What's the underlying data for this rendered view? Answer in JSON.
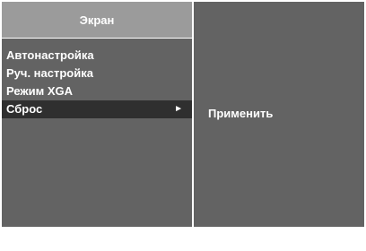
{
  "left_panel": {
    "title": "Экран",
    "items": [
      {
        "label": "Автонастройка",
        "selected": false
      },
      {
        "label": "Руч. настройка",
        "selected": false
      },
      {
        "label": "Режим XGA",
        "selected": false
      },
      {
        "label": "Сброс",
        "selected": true,
        "submenu_icon": "right-triangle-icon",
        "submenu_glyph": "►"
      }
    ]
  },
  "right_panel": {
    "option": "Применить"
  },
  "colors": {
    "panel_bg": "#636363",
    "title_bg": "#9b9b9b",
    "selected_bg": "#2f2f2f",
    "text": "#ffffff"
  }
}
